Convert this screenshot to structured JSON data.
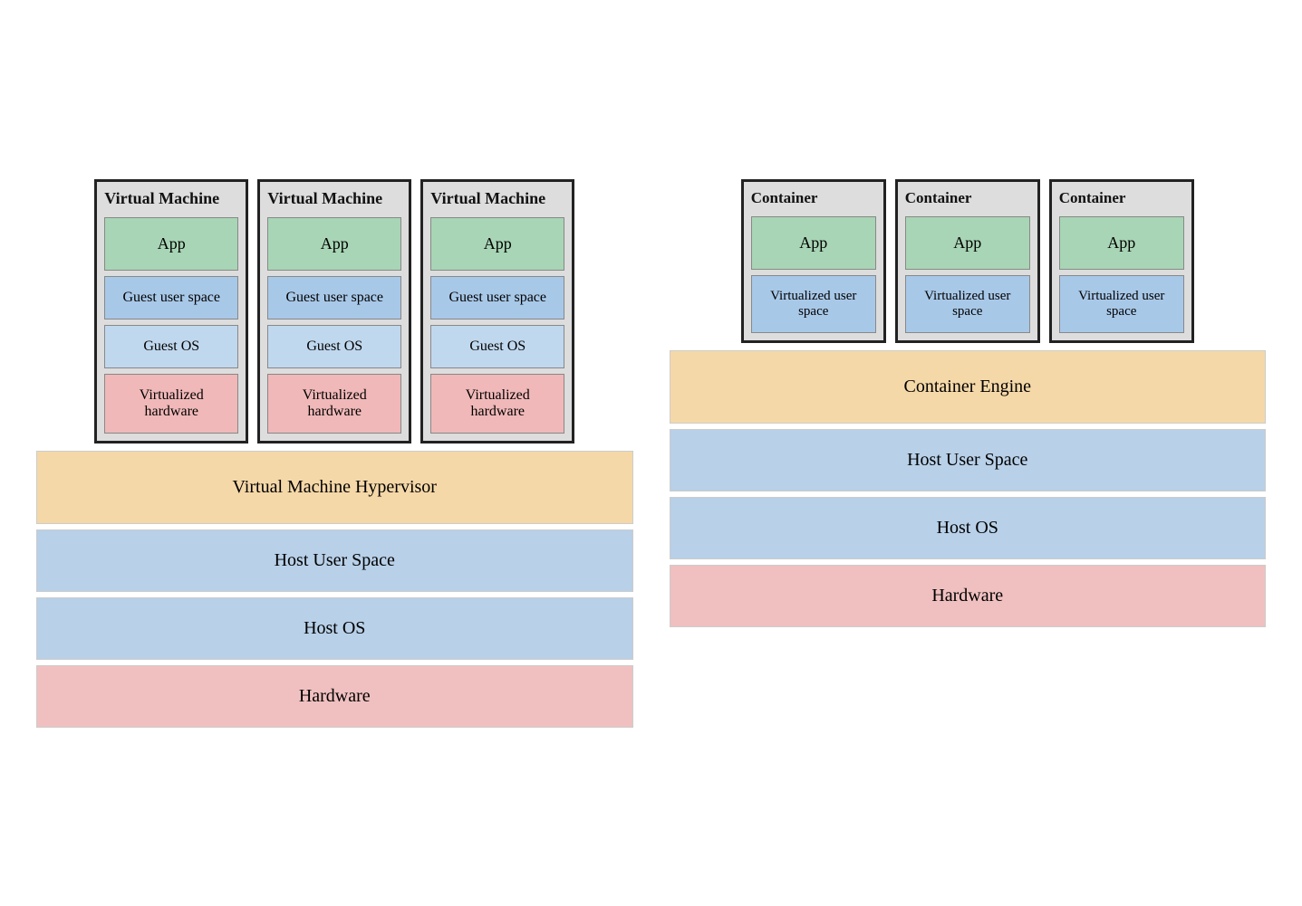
{
  "left": {
    "vms": [
      {
        "title": "Virtual Machine",
        "app": "App",
        "guestUser": "Guest user space",
        "guestOS": "Guest OS",
        "virtHW": "Virtualized hardware"
      },
      {
        "title": "Virtual Machine",
        "app": "App",
        "guestUser": "Guest user space",
        "guestOS": "Guest OS",
        "virtHW": "Virtualized hardware"
      },
      {
        "title": "Virtual Machine",
        "app": "App",
        "guestUser": "Guest user space",
        "guestOS": "Guest OS",
        "virtHW": "Virtualized hardware"
      }
    ],
    "hypervisor": "Virtual Machine Hypervisor",
    "hostUser": "Host User Space",
    "hostOS": "Host OS",
    "hardware": "Hardware"
  },
  "right": {
    "containers": [
      {
        "title": "Container",
        "app": "App",
        "virtUser": "Virtualized user space"
      },
      {
        "title": "Container",
        "app": "App",
        "virtUser": "Virtualized user space"
      },
      {
        "title": "Container",
        "app": "App",
        "virtUser": "Virtualized user space"
      }
    ],
    "engine": "Container Engine",
    "hostUser": "Host User Space",
    "hostOS": "Host OS",
    "hardware": "Hardware"
  }
}
